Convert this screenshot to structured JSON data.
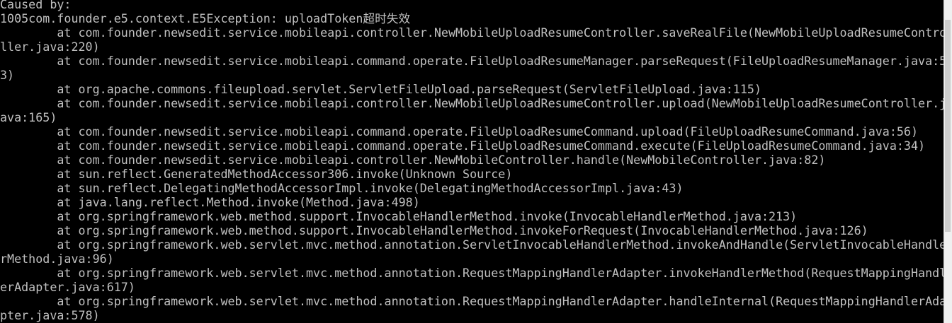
{
  "terminal": {
    "lines": [
      "Caused by:",
      "1005com.founder.e5.context.E5Exception: uploadToken超时失效",
      "        at com.founder.newsedit.service.mobileapi.controller.NewMobileUploadResumeController.saveRealFile(NewMobileUploadResumeContro",
      "ller.java:220)",
      "        at com.founder.newsedit.service.mobileapi.command.operate.FileUploadResumeManager.parseRequest(FileUploadResumeManager.java:5",
      "3)",
      "        at org.apache.commons.fileupload.servlet.ServletFileUpload.parseRequest(ServletFileUpload.java:115)",
      "        at com.founder.newsedit.service.mobileapi.controller.NewMobileUploadResumeController.upload(NewMobileUploadResumeController.j",
      "ava:165)",
      "        at com.founder.newsedit.service.mobileapi.command.operate.FileUploadResumeCommand.upload(FileUploadResumeCommand.java:56)",
      "        at com.founder.newsedit.service.mobileapi.command.operate.FileUploadResumeCommand.execute(FileUploadResumeCommand.java:34)",
      "        at com.founder.newsedit.service.mobileapi.controller.NewMobileController.handle(NewMobileController.java:82)",
      "        at sun.reflect.GeneratedMethodAccessor306.invoke(Unknown Source)",
      "        at sun.reflect.DelegatingMethodAccessorImpl.invoke(DelegatingMethodAccessorImpl.java:43)",
      "        at java.lang.reflect.Method.invoke(Method.java:498)",
      "        at org.springframework.web.method.support.InvocableHandlerMethod.invoke(InvocableHandlerMethod.java:213)",
      "        at org.springframework.web.method.support.InvocableHandlerMethod.invokeForRequest(InvocableHandlerMethod.java:126)",
      "        at org.springframework.web.servlet.mvc.method.annotation.ServletInvocableHandlerMethod.invokeAndHandle(ServletInvocableHandle",
      "rMethod.java:96)",
      "        at org.springframework.web.servlet.mvc.method.annotation.RequestMappingHandlerAdapter.invokeHandlerMethod(RequestMappingHandl",
      "erAdapter.java:617)",
      "        at org.springframework.web.servlet.mvc.method.annotation.RequestMappingHandlerAdapter.handleInternal(RequestMappingHandlerAda",
      "pter.java:578)"
    ]
  },
  "colors": {
    "background": "#000000",
    "text": "#c0c0c0",
    "scrollbar_track": "#f0f0f0",
    "scrollbar_thumb": "#cdcdcd"
  }
}
